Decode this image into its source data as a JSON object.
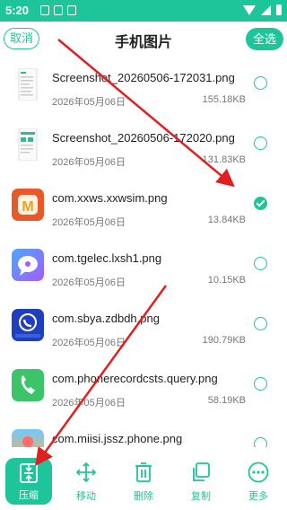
{
  "status_bar": {
    "time": "5:20",
    "icons": [
      "screenshot-icon",
      "notification-icon",
      "a-icon",
      "wifi-icon",
      "signal-icon",
      "battery-icon"
    ]
  },
  "header": {
    "cancel_label": "取消",
    "title": "手机图片",
    "select_all_label": "全选"
  },
  "files": [
    {
      "name": "Screenshot_20260506-172031.png",
      "date": "2026年05月06日",
      "size": "155.18KB",
      "selected": false,
      "thumb": "screenshot-thumb"
    },
    {
      "name": "Screenshot_20260506-172020.png",
      "date": "2026年05月06日",
      "size": "131.83KB",
      "selected": false,
      "thumb": "screenshot-thumb"
    },
    {
      "name": "com.xxws.xxwsim.png",
      "date": "2026年05月06日",
      "size": "13.84KB",
      "selected": true,
      "thumb": "app-icon-m"
    },
    {
      "name": "com.tgelec.lxsh1.png",
      "date": "2026年05月06日",
      "size": "10.15KB",
      "selected": false,
      "thumb": "app-icon-chat"
    },
    {
      "name": "com.sbya.zdbdh.png",
      "date": "2026年05月06日",
      "size": "190.79KB",
      "selected": false,
      "thumb": "app-icon-phone-blue"
    },
    {
      "name": "com.phonerecordcsts.query.png",
      "date": "2026年05月06日",
      "size": "58.19KB",
      "selected": false,
      "thumb": "app-icon-phone-green"
    },
    {
      "name": "com.miisi.jssz.phone.png",
      "date": "",
      "size": "",
      "selected": false,
      "thumb": "app-icon-colorful"
    }
  ],
  "toolbar": {
    "compress_label": "压缩",
    "move_label": "移动",
    "delete_label": "删除",
    "copy_label": "复制",
    "more_label": "更多"
  },
  "colors": {
    "accent": "#1ec49a",
    "annotation_arrow": "#e02020"
  }
}
